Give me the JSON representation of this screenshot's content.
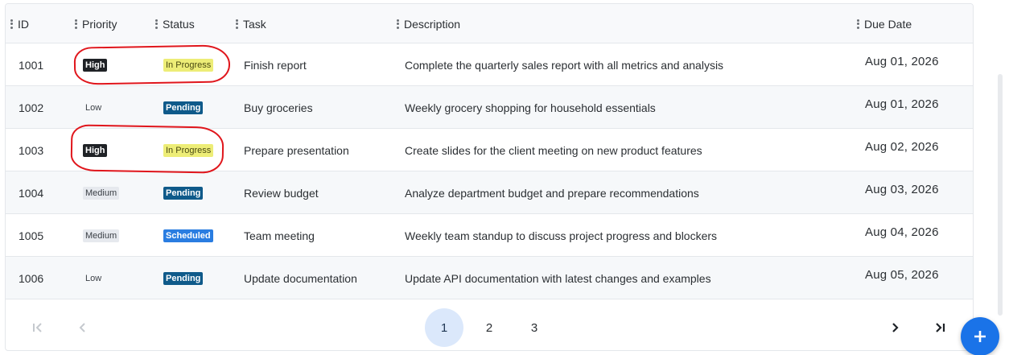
{
  "columns": {
    "id": "ID",
    "priority": "Priority",
    "status": "Status",
    "task": "Task",
    "description": "Description",
    "due_date": "Due Date"
  },
  "rows": [
    {
      "id": "1001",
      "priority": "High",
      "status": "In Progress",
      "task": "Finish report",
      "description": "Complete the quarterly sales report with all metrics and analysis",
      "due_date": "Aug 01, 2026"
    },
    {
      "id": "1002",
      "priority": "Low",
      "status": "Pending",
      "task": "Buy groceries",
      "description": "Weekly grocery shopping for household essentials",
      "due_date": "Aug 01, 2026"
    },
    {
      "id": "1003",
      "priority": "High",
      "status": "In Progress",
      "task": "Prepare presentation",
      "description": "Create slides for the client meeting on new product features",
      "due_date": "Aug 02, 2026"
    },
    {
      "id": "1004",
      "priority": "Medium",
      "status": "Pending",
      "task": "Review budget",
      "description": "Analyze department budget and prepare recommendations",
      "due_date": "Aug 03, 2026"
    },
    {
      "id": "1005",
      "priority": "Medium",
      "status": "Scheduled",
      "task": "Team meeting",
      "description": "Weekly team standup to discuss project progress and blockers",
      "due_date": "Aug 04, 2026"
    },
    {
      "id": "1006",
      "priority": "Low",
      "status": "Pending",
      "task": "Update documentation",
      "description": "Update API documentation with latest changes and examples",
      "due_date": "Aug 05, 2026"
    }
  ],
  "pagination": {
    "pages": [
      "1",
      "2",
      "3"
    ],
    "current_page": "1",
    "first_icon": "first-page-icon",
    "prev_icon": "chevron-left-icon",
    "next_icon": "chevron-right-icon",
    "last_icon": "last-page-icon"
  },
  "fab": {
    "icon": "plus-icon"
  },
  "colors": {
    "annotation": "#e0161c",
    "high": "#1f2226",
    "in_progress": "#eded77",
    "pending": "#0f5a8a",
    "scheduled": "#2a7de1",
    "medium": "#e6e9ee",
    "active_page": "#dbe8fb",
    "fab": "#1a73e8"
  }
}
